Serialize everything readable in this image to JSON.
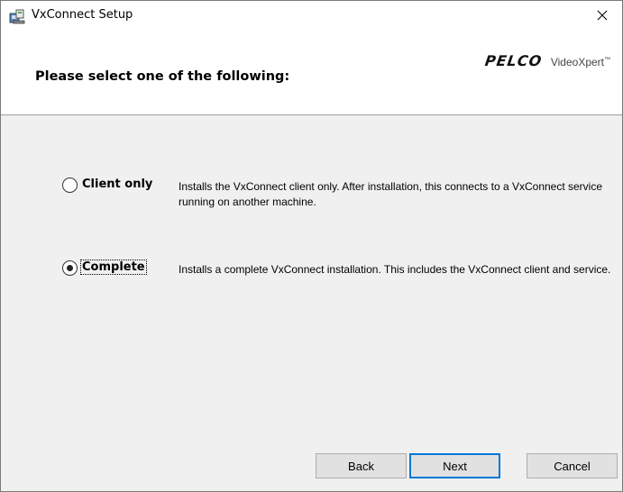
{
  "window": {
    "title": "VxConnect Setup",
    "icon": "installer-icon",
    "close_glyph": "✕"
  },
  "header": {
    "title": "Please select one of the following:",
    "brand": "PELCO",
    "product": "VideoXpert",
    "tm": "™"
  },
  "options": [
    {
      "label": "Client only",
      "selected": false,
      "description": "Installs the VxConnect client only.  After installation, this connects to a VxConnect service running on another machine."
    },
    {
      "label": "Complete",
      "selected": true,
      "description": "Installs a complete VxConnect installation.  This includes the VxConnect client and service."
    }
  ],
  "buttons": {
    "back": "Back",
    "next": "Next",
    "cancel": "Cancel"
  },
  "colors": {
    "accent": "#0078d7",
    "dialog_bg": "#f0f0f0",
    "button_bg": "#e1e1e1"
  }
}
